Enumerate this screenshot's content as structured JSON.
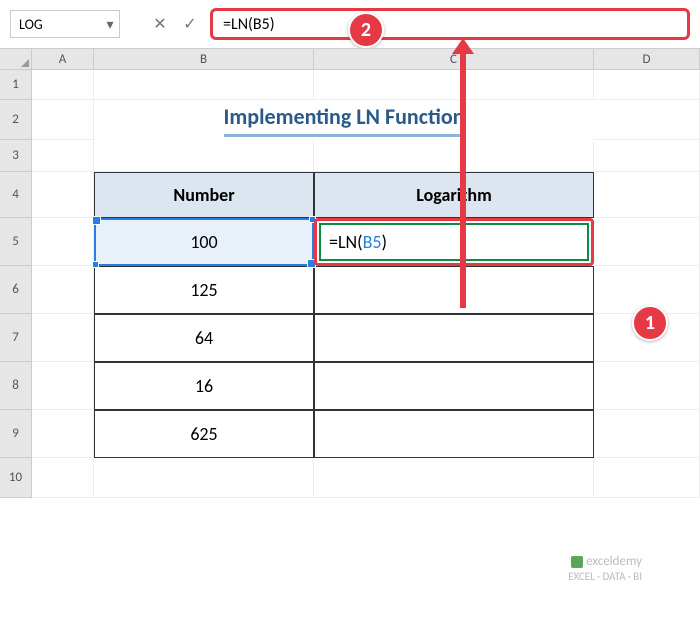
{
  "namebox": {
    "value": "LOG"
  },
  "formula_bar": {
    "text": "=LN(B5)"
  },
  "columns": {
    "a": "A",
    "b": "B",
    "c": "C",
    "d": "D"
  },
  "rows": {
    "r1": "1",
    "r2": "2",
    "r3": "3",
    "r4": "4",
    "r5": "5",
    "r6": "6",
    "r7": "7",
    "r8": "8",
    "r9": "9",
    "r10": "10"
  },
  "title": "Implementing LN Function",
  "table": {
    "headers": {
      "number": "Number",
      "logarithm": "Logarithm"
    },
    "rows": [
      {
        "number": "100",
        "log": "=LN("
      },
      {
        "number": "125",
        "log": ""
      },
      {
        "number": "64",
        "log": ""
      },
      {
        "number": "16",
        "log": ""
      },
      {
        "number": "625",
        "log": ""
      }
    ],
    "c5_ref": "B5",
    "c5_close": ")"
  },
  "callouts": {
    "one": "1",
    "two": "2"
  },
  "watermark": {
    "brand": "exceldemy",
    "tagline": "EXCEL · DATA · BI"
  }
}
